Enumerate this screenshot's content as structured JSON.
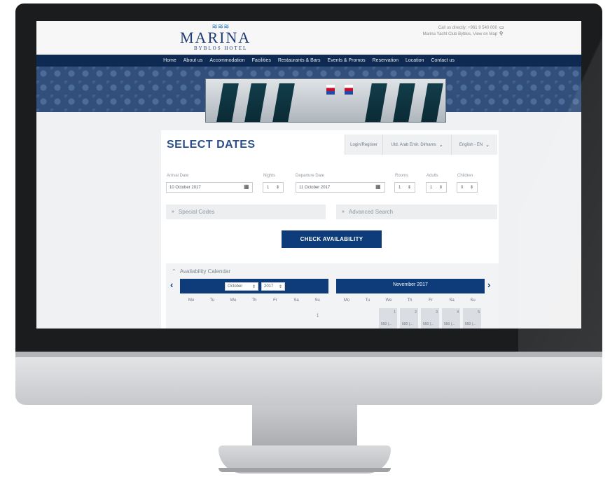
{
  "header": {
    "logo_main": "MARINA",
    "logo_sub": "BYBLOS HOTEL",
    "contact_line1": "Call us directly: +961 9 540 000",
    "contact_line2": "Marina Yacht Club Byblos, View on Map"
  },
  "nav": {
    "items": [
      "Home",
      "About us",
      "Accommodation",
      "Facilities",
      "Restaurants & Bars",
      "Events & Promos",
      "Reservation",
      "Location",
      "Contact us"
    ]
  },
  "booking": {
    "title": "SELECT DATES",
    "login_label": "Login/Register",
    "currency_label": "Utd. Arab Emir. Dirhams",
    "language_label": "English - EN",
    "arrival_label": "Arrival Date",
    "arrival_value": "10 October 2017",
    "nights_label": "Nights",
    "nights_value": "1",
    "departure_label": "Departure Date",
    "departure_value": "11 October 2017",
    "rooms_label": "Rooms",
    "rooms_value": "1",
    "adults_label": "Adults",
    "adults_value": "1",
    "children_label": "Children",
    "children_value": "0",
    "special_codes": "Special Codes",
    "advanced_search": "Advanced Search",
    "check_button": "CHECK AVAILABILITY"
  },
  "calendar": {
    "title": "Availability Calendar",
    "month_select": "October",
    "year_select": "2017",
    "right_month": "November 2017",
    "weekdays": [
      "Mo",
      "Tu",
      "We",
      "Th",
      "Fr",
      "Sa",
      "Su"
    ],
    "left_first_day": "1",
    "right_days": [
      {
        "day": "1",
        "price": "550 (..."
      },
      {
        "day": "2",
        "price": "600 (..."
      },
      {
        "day": "3",
        "price": "550 (..."
      },
      {
        "day": "4",
        "price": "550 (..."
      },
      {
        "day": "5",
        "price": "550 (..."
      }
    ]
  }
}
